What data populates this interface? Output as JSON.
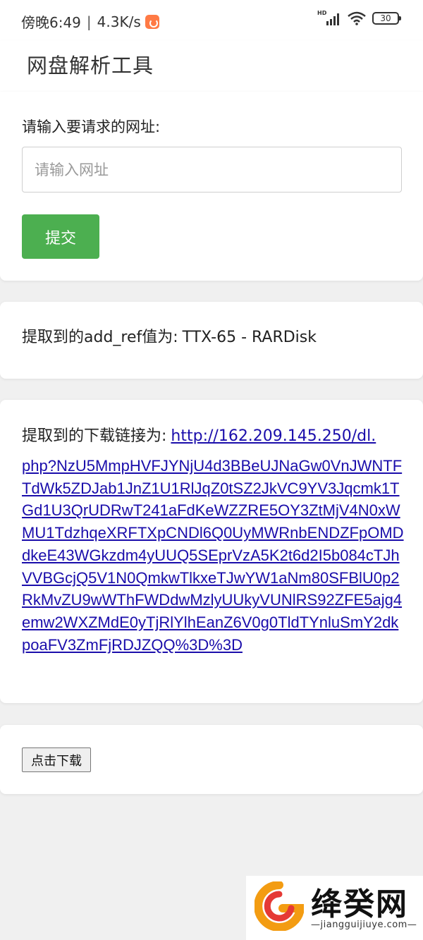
{
  "statusbar": {
    "time": "傍晚6:49",
    "separator": "|",
    "speed": "4.3K/s",
    "network": "HD",
    "battery": "30"
  },
  "appbar": {
    "title": "网盘解析工具"
  },
  "form": {
    "label": "请输入要请求的网址:",
    "input_placeholder": "请输入网址",
    "input_value": "",
    "submit_label": "提交"
  },
  "ref": {
    "label": "提取到的add_ref值为:",
    "value": "TTX-65 - RARDisk"
  },
  "download_link": {
    "label": "提取到的下载链接为:",
    "url_first": "http://162.209.145.250/dl.",
    "url_rest": "php?NzU5MmpHVFJYNjU4d3BBeUJNaGw0VnJWNTFTdWk5ZDJab1JnZ1U1RlJqZ0tSZ2JkVC9YV3Jqcmk1TGd1U3QrUDRwT241aFdKeWZZRE5OY3ZtMjV4N0xWMU1TdzhqeXRFTXpCNDl6Q0UyMWRnbENDZFpOMDdkeE43WGkzdm4yUUQ5SEprVzA5K2t6d2I5b084cTJhVVBGcjQ5V1N0QmkwTlkxeTJwYW1aNm80SFBlU0p2RkMvZU9wWThFWDdwMzlyUUkyVUNlRS92ZFE5ajg4emw2WXZMdE0yTjRlYlhEanZ6V0g0TldTYnluSmY2dkpoaFV3ZmFjRDJZQQ%3D%3D"
  },
  "download_button": {
    "label": "点击下载"
  },
  "watermark": {
    "name": "绛癸网",
    "sub": "—jiangguijiuye.com—",
    "logo_colors": [
      "#f39c12",
      "#e53935"
    ]
  }
}
